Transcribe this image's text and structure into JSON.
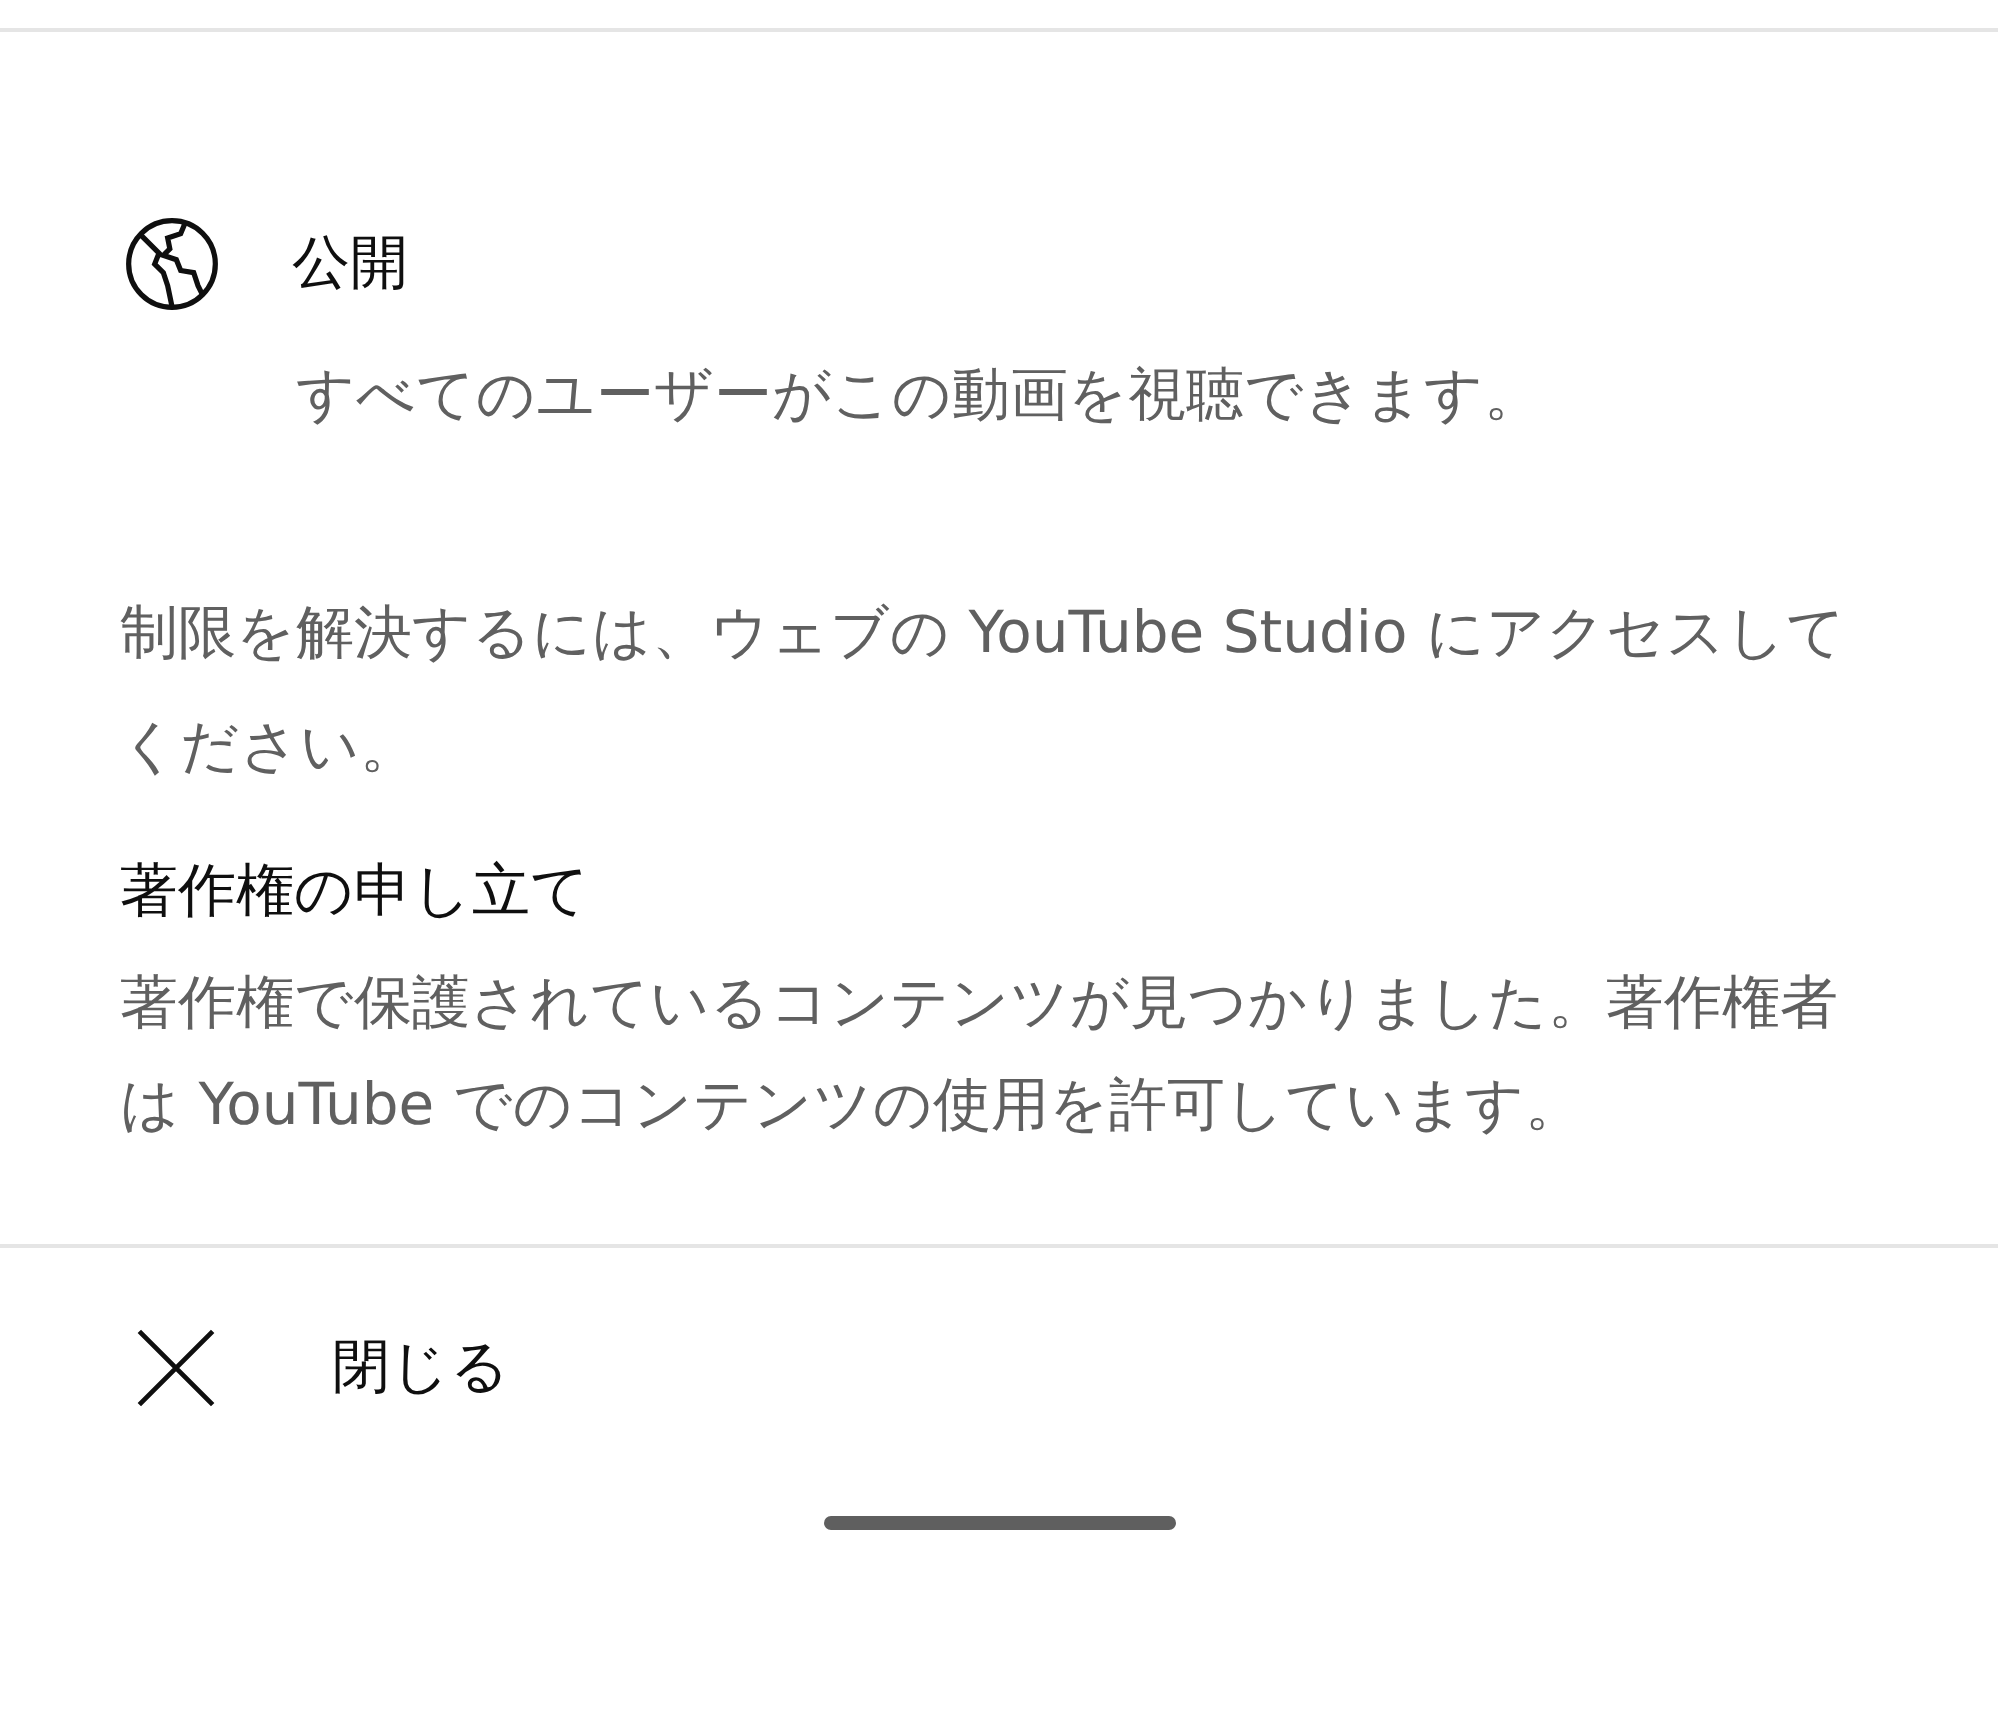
{
  "visibility": {
    "title": "公開",
    "description": "すべてのユーザーがこの動画を視聴できます。"
  },
  "notice": "制限を解決するには、ウェブの YouTube Studio にアクセスしてください。",
  "claim": {
    "title": "著作権の申し立て",
    "body": "著作権で保護されているコンテンツが見つかりました。著作権者は YouTube でのコンテンツの使用を許可しています。"
  },
  "close_button": {
    "label": "閉じる"
  }
}
